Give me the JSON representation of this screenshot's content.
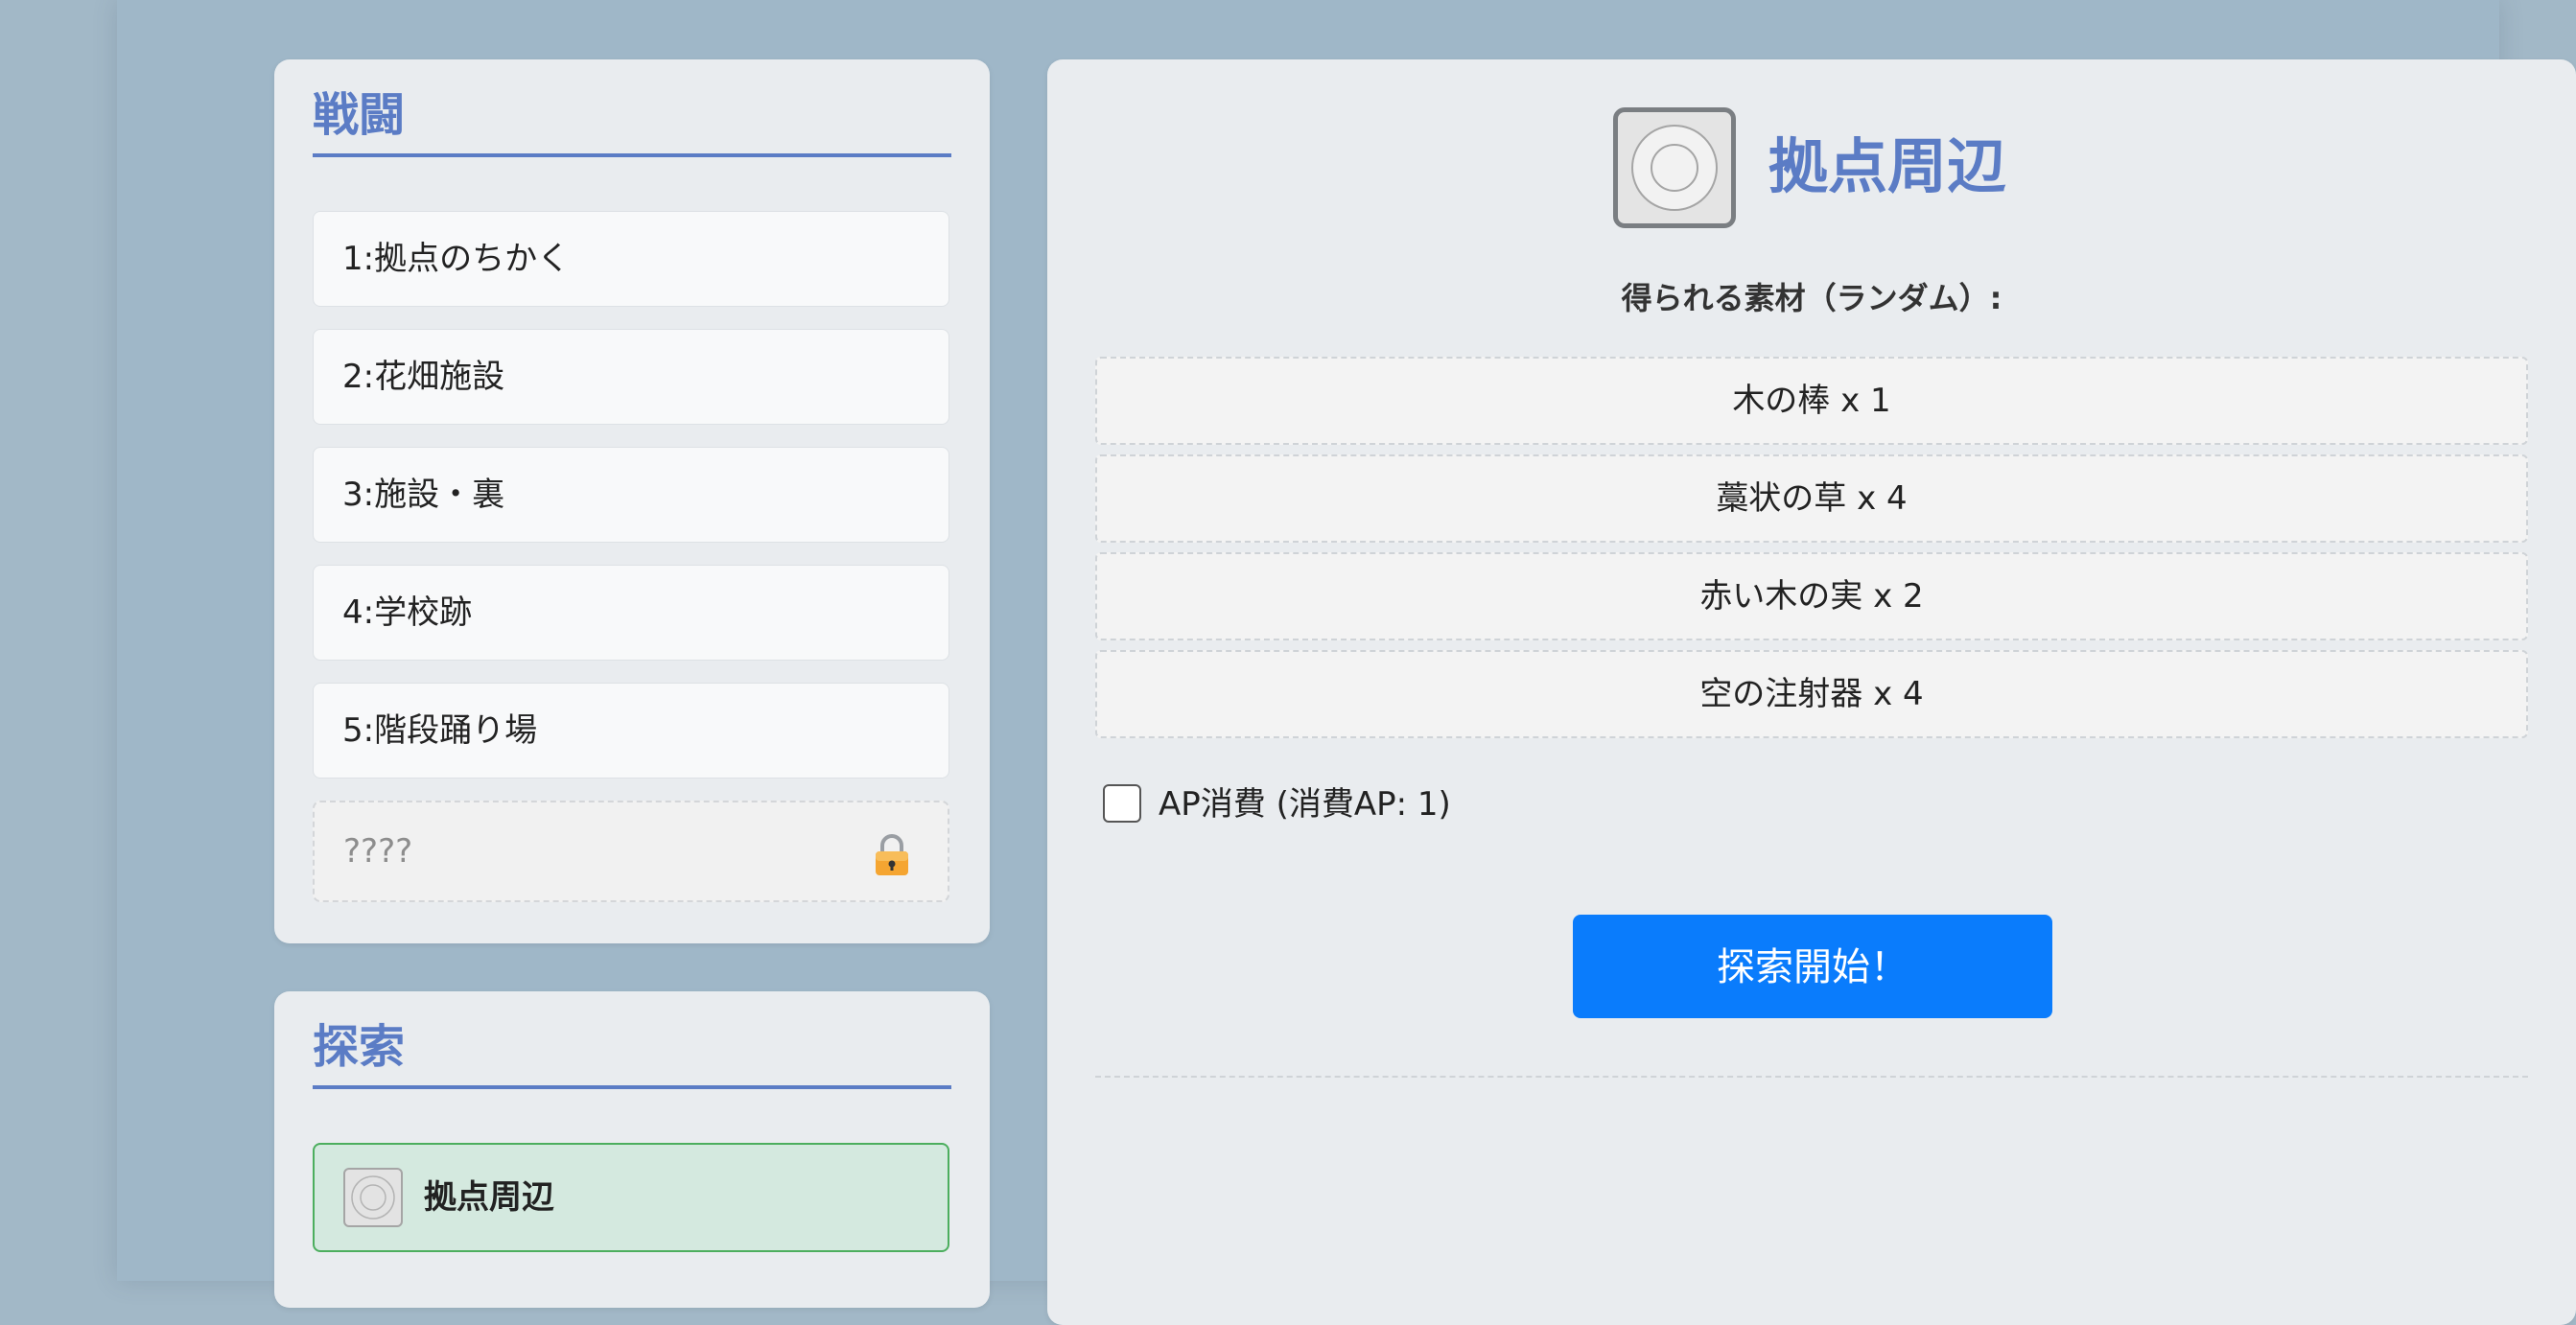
{
  "battle": {
    "title": "戦闘",
    "stages": [
      {
        "label": "1:拠点のちかく"
      },
      {
        "label": "2:花畑施設"
      },
      {
        "label": "3:施設・裏"
      },
      {
        "label": "4:学校跡"
      },
      {
        "label": "5:階段踊り場"
      }
    ],
    "locked": {
      "label": "????",
      "icon": "lock-icon"
    }
  },
  "explore": {
    "title": "探索",
    "selected": {
      "label": "拠点周辺",
      "icon": "target-icon"
    }
  },
  "detail": {
    "title": "拠点周辺",
    "icon": "target-icon",
    "materials_label": "得られる素材（ランダム）:",
    "materials": [
      {
        "label": "木の棒 x 1"
      },
      {
        "label": "藁状の草 x 4"
      },
      {
        "label": "赤い木の実 x 2"
      },
      {
        "label": "空の注射器 x 4"
      }
    ],
    "ap_label": "AP消費 (消費AP: 1)",
    "ap_checked": false,
    "start_label": "探索開始！"
  },
  "colors": {
    "accent": "#5b7cc5",
    "button": "#0a7cfc",
    "selected_bg": "#d4e9df",
    "selected_border": "#4cae5e"
  }
}
